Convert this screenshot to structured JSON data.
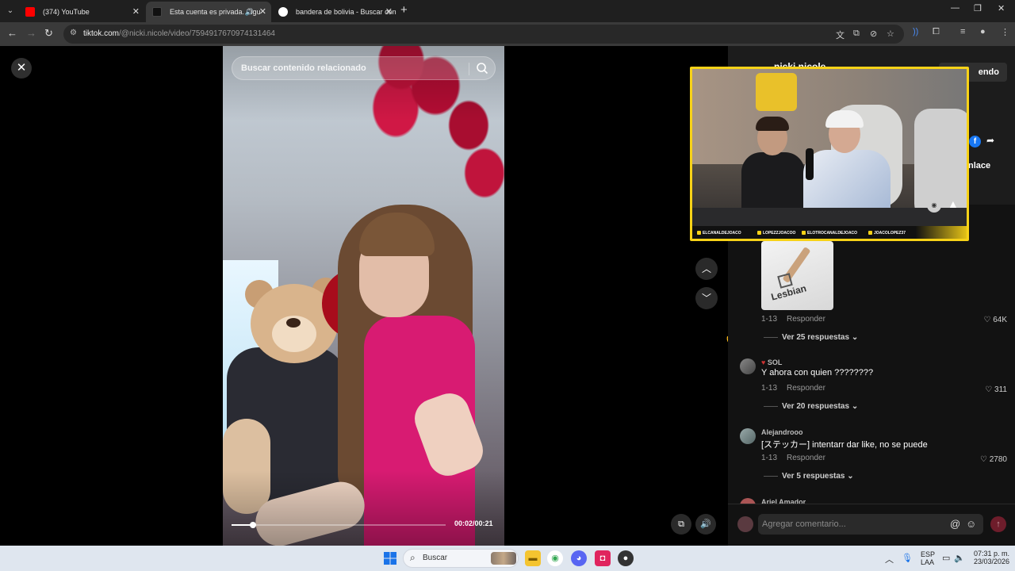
{
  "browser": {
    "tabs": [
      {
        "title": "(374) YouTube",
        "active": false
      },
      {
        "title": "Esta cuenta es privada. Sigu",
        "active": true
      },
      {
        "title": "bandera de bolivia - Buscar con",
        "active": false
      }
    ],
    "url_host": "tiktok.com",
    "url_path": "/@nicki.nicole/video/7594917670974131464",
    "new_tab": "+",
    "minimize": "—",
    "restore": "❐",
    "close": "✕"
  },
  "video": {
    "search_placeholder": "Buscar contenido relacionado",
    "timecode": "00:02/00:21",
    "progress": 0.1
  },
  "panel": {
    "creator": "nicki.nicole",
    "follow_label": "endo",
    "copy_link_label": "nlace",
    "comments": [
      {
        "user": "",
        "text": "",
        "sticker_word": "Lesbian",
        "date": "1-13",
        "reply": "Responder",
        "likes": "64K",
        "replies": "Ver 25 respuestas"
      },
      {
        "user": "SOL",
        "text": "Y ahora con quien ????????",
        "date": "1-13",
        "reply": "Responder",
        "likes": "311",
        "replies": "Ver 20 respuestas"
      },
      {
        "user": "Alejandrooo",
        "text": "[ステッカー] intentarr dar like, no se puede",
        "date": "1-13",
        "reply": "Responder",
        "likes": "2780",
        "replies": "Ver 5 respuestas"
      },
      {
        "user": "Ariel Amador",
        "text": "",
        "date": "",
        "reply": "",
        "likes": "",
        "replies": ""
      }
    ],
    "comment_placeholder": "Agregar comentario..."
  },
  "stream_overlay": {
    "ticker": [
      "ELCANALDEJOACO",
      "LOPEZZJOACOO",
      "ELOTROCANALDEJOACO",
      "JOACOLOPEZ37"
    ],
    "accent": "#f7d218"
  },
  "taskbar": {
    "search_label": "Buscar",
    "lang_top": "ESP",
    "lang_bottom": "LAA",
    "time": "07:31 p. m.",
    "date": "23/03/2026"
  },
  "colors": {
    "tiktok_bg": "#121212",
    "facebook": "#1877f2",
    "send_disabled": "#6e1d2b"
  }
}
